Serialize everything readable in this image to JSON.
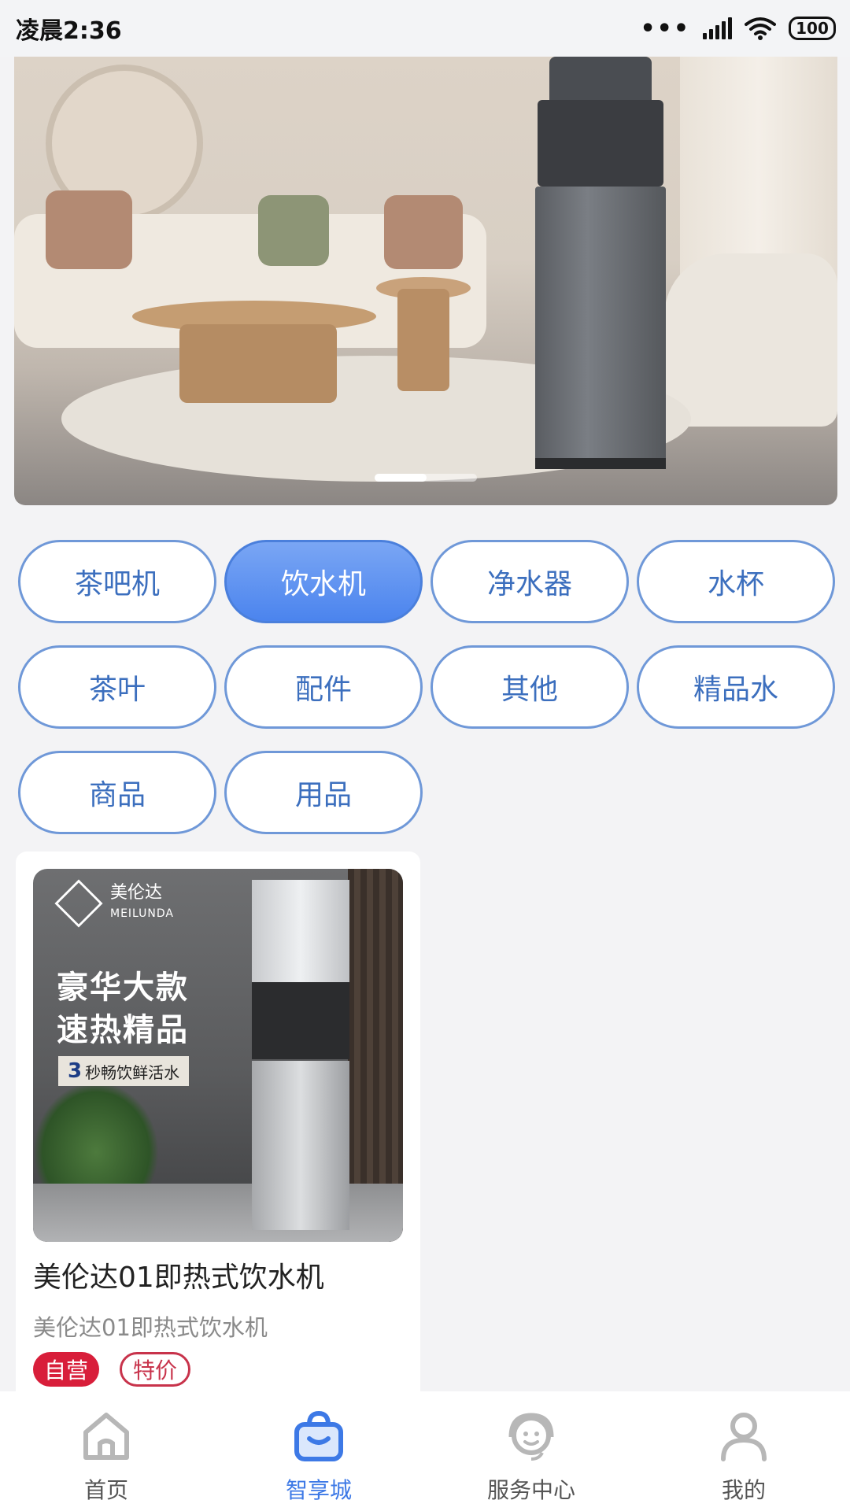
{
  "status_bar": {
    "time": "凌晨2:36",
    "battery": "100"
  },
  "categories": [
    {
      "label": "茶吧机",
      "active": false
    },
    {
      "label": "饮水机",
      "active": true
    },
    {
      "label": "净水器",
      "active": false
    },
    {
      "label": "水杯",
      "active": false
    },
    {
      "label": "茶叶",
      "active": false
    },
    {
      "label": "配件",
      "active": false
    },
    {
      "label": "其他",
      "active": false
    },
    {
      "label": "精品水",
      "active": false
    },
    {
      "label": "商品",
      "active": false
    },
    {
      "label": "用品",
      "active": false
    }
  ],
  "product": {
    "image": {
      "brand_cn": "美伦达",
      "brand_en": "MEILUNDA",
      "slogan_line1": "豪华大款",
      "slogan_line2": "速热精品",
      "tagline_number": "3",
      "tagline_text": "秒畅饮鲜活水"
    },
    "title": "美伦达01即热式饮水机",
    "subtitle": "美伦达01即热式饮水机",
    "badges": [
      "自营",
      "特价"
    ]
  },
  "tabbar": {
    "items": [
      {
        "label": "首页",
        "icon": "home-icon",
        "active": false
      },
      {
        "label": "智享城",
        "icon": "shopping-bag-icon",
        "active": true
      },
      {
        "label": "服务中心",
        "icon": "customer-service-icon",
        "active": false
      },
      {
        "label": "我的",
        "icon": "user-icon",
        "active": false
      }
    ]
  },
  "colors": {
    "accent": "#3d79e6",
    "chip_border": "#6f98d8",
    "badge_red": "#d81e3a"
  }
}
